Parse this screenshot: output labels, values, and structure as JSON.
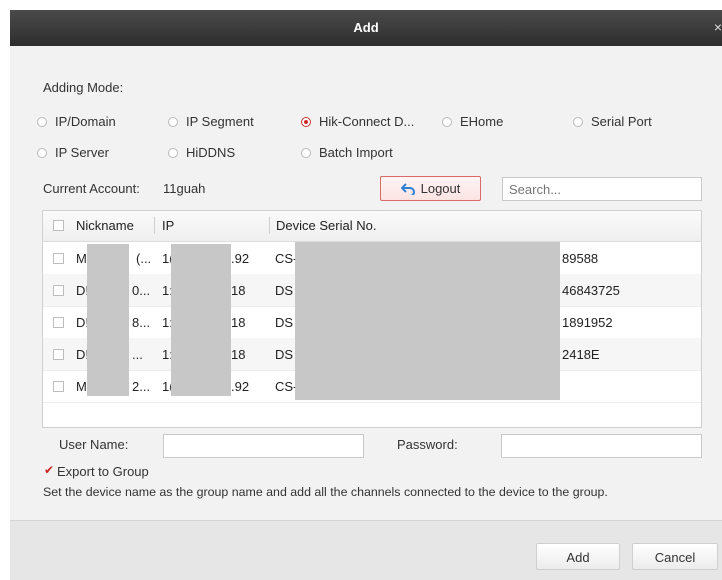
{
  "window": {
    "title": "Add",
    "close_glyph": "×"
  },
  "adding_mode": {
    "label": "Adding Mode:",
    "options": [
      {
        "label": "IP/Domain",
        "selected": false
      },
      {
        "label": "IP Segment",
        "selected": false
      },
      {
        "label": "Hik-Connect D...",
        "selected": true
      },
      {
        "label": "EHome",
        "selected": false
      },
      {
        "label": "Serial Port",
        "selected": false
      },
      {
        "label": "IP Server",
        "selected": false
      },
      {
        "label": "HiDDNS",
        "selected": false
      },
      {
        "label": "Batch Import",
        "selected": false
      }
    ]
  },
  "account": {
    "label": "Current Account:",
    "value": "11guah",
    "logout_label": "Logout",
    "search_placeholder": "Search..."
  },
  "table": {
    "headers": {
      "nickname": "Nickname",
      "ip": "IP",
      "serial": "Device Serial No."
    },
    "rows": [
      {
        "nick_a": "M",
        "nick_b": "(...",
        "ip_a": "1(",
        "ip_b": ".92",
        "serial_a": "CS-",
        "serial_b": "89588"
      },
      {
        "nick_a": "D!",
        "nick_b": "0...",
        "ip_a": "1:",
        "ip_b": "18",
        "serial_a": "DS",
        "serial_b": "46843725"
      },
      {
        "nick_a": "D!",
        "nick_b": "8...",
        "ip_a": "1:",
        "ip_b": "18",
        "serial_a": "DS",
        "serial_b": "1891952"
      },
      {
        "nick_a": "D!",
        "nick_b": "...",
        "ip_a": "1:",
        "ip_b": "18",
        "serial_a": "DS",
        "serial_b": "2418E"
      },
      {
        "nick_a": "M",
        "nick_b": "2...",
        "ip_a": "1(",
        "ip_b": ".92",
        "serial_a": "CS-",
        "serial_b": ""
      }
    ]
  },
  "credentials": {
    "username_label": "User Name:",
    "password_label": "Password:"
  },
  "export": {
    "label": "Export to Group",
    "checked": true,
    "description": "Set the device name as the group name and add all the channels connected to the device to the group."
  },
  "footer": {
    "add_label": "Add",
    "cancel_label": "Cancel"
  },
  "colors": {
    "accent": "#d12a2a",
    "titlebar": "#2e2e2e"
  }
}
